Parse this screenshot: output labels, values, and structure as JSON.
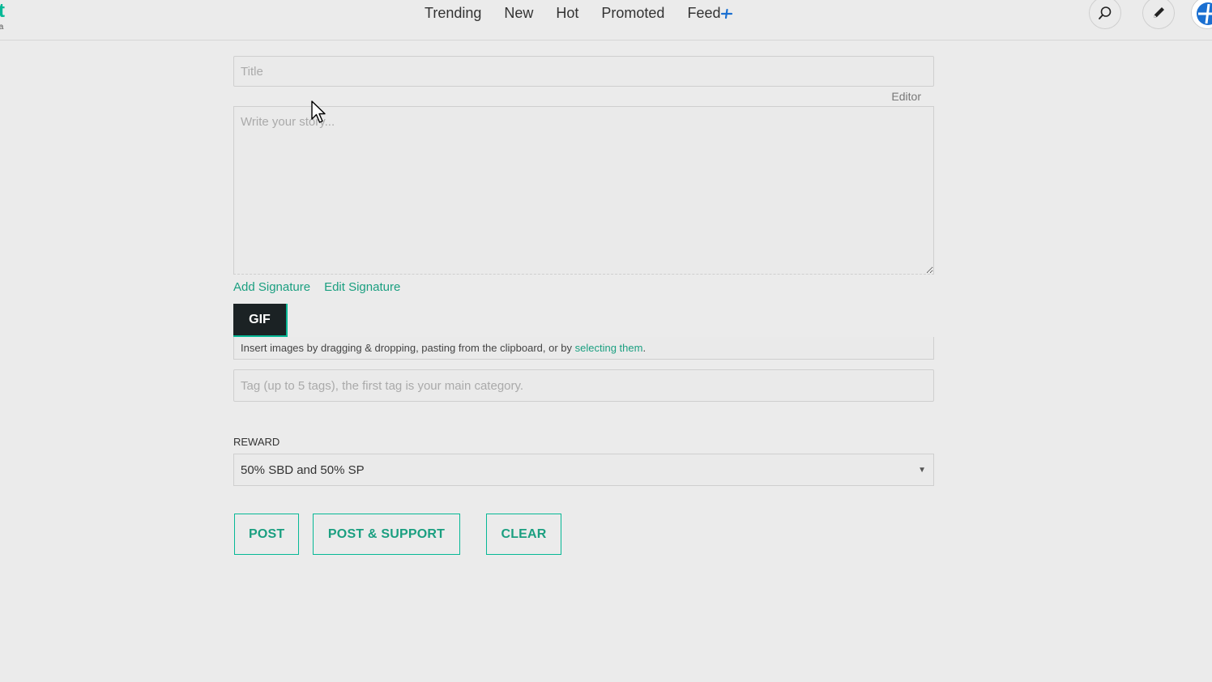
{
  "header": {
    "logo_mark": "t",
    "logo_sub": "ta",
    "nav": [
      {
        "label": "Trending"
      },
      {
        "label": "New"
      },
      {
        "label": "Hot"
      },
      {
        "label": "Promoted"
      },
      {
        "label": "Feed"
      }
    ],
    "icons": {
      "search": "search-icon",
      "pen": "pencil-icon",
      "avatar": "avatar"
    }
  },
  "editor": {
    "title_placeholder": "Title",
    "title_value": "",
    "editor_toggle_label": "Editor",
    "story_placeholder": "Write your story...",
    "story_value": "",
    "add_signature": "Add Signature",
    "edit_signature": "Edit Signature",
    "gif_label": "GIF",
    "insert_text": "Insert images by dragging & dropping, pasting from the clipboard, or by ",
    "insert_link": "selecting them",
    "insert_end": ".",
    "tags_placeholder": "Tag (up to 5 tags), the first tag is your main category.",
    "tags_value": "",
    "reward_label": "REWARD",
    "reward_selected": "50% SBD and 50% SP"
  },
  "actions": {
    "post": "POST",
    "post_support": "POST & SUPPORT",
    "clear": "CLEAR"
  },
  "colors": {
    "accent": "#06b896",
    "link": "#1a9f80",
    "gif_bg": "#1b2224",
    "background": "#ebebeb"
  }
}
